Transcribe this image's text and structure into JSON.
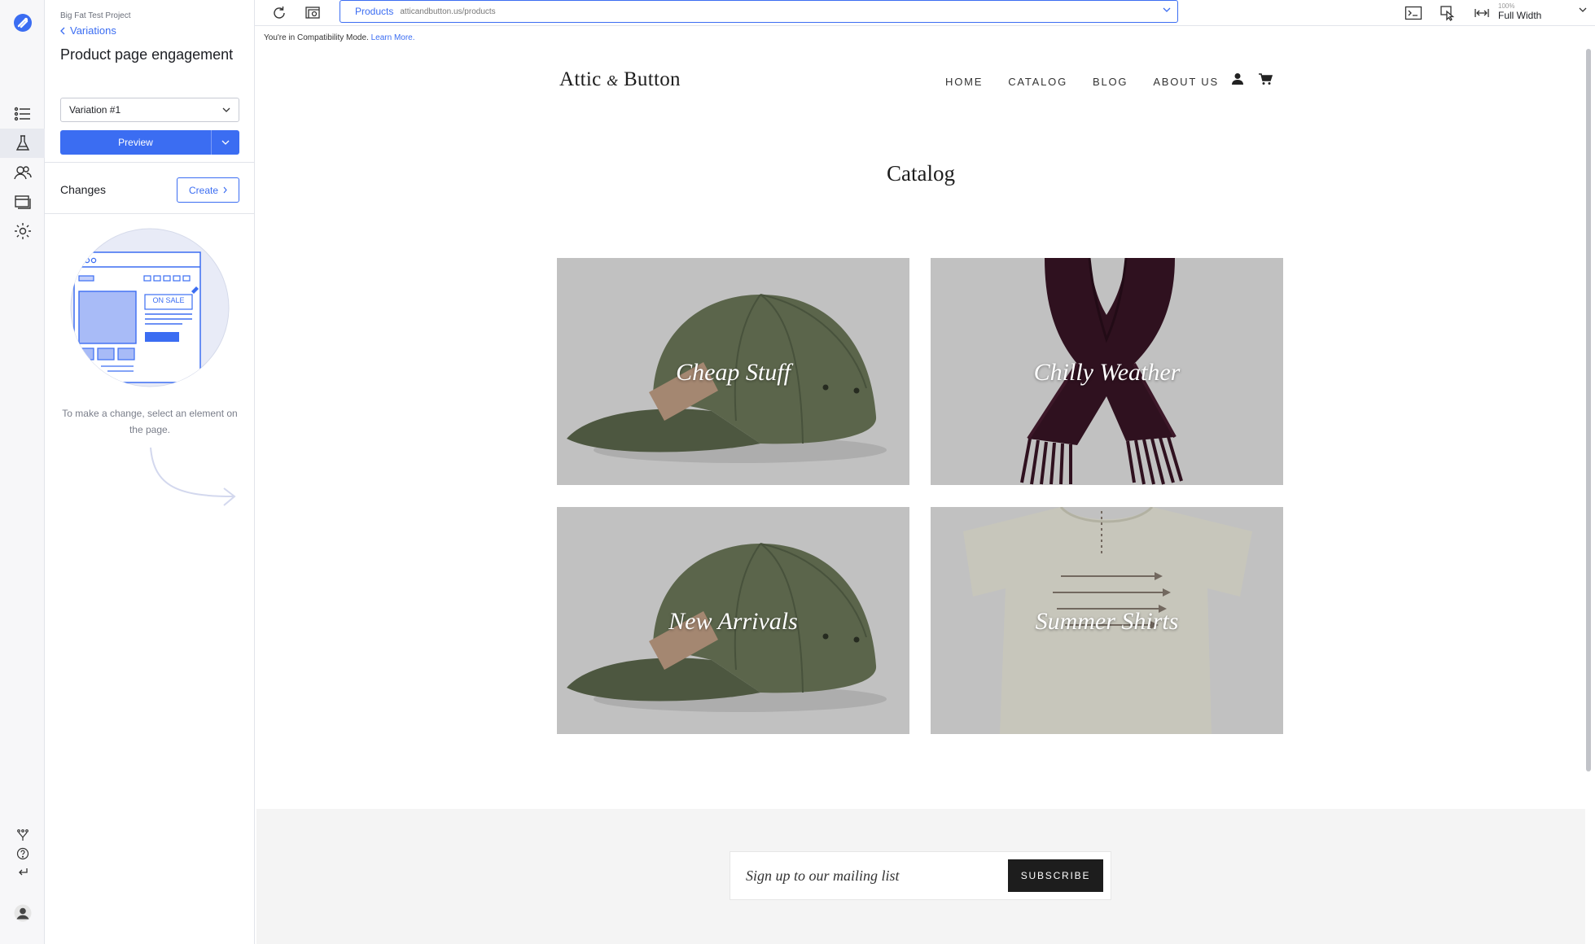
{
  "editor": {
    "project_name": "Big Fat Test Project",
    "back_label": "Variations",
    "title": "Product page engagement",
    "variation_selected": "Variation #1",
    "preview_label": "Preview",
    "changes_label": "Changes",
    "create_label": "Create",
    "hint_text": "To make a change, select an element on the page.",
    "illustration_badge": "ON SALE"
  },
  "toolbar": {
    "url_page": "Products",
    "url_address": "atticandbutton.us/products",
    "zoom_percent": "100%",
    "zoom_mode": "Full Width"
  },
  "compat": {
    "message": "You're in Compatibility Mode.",
    "link": "Learn More."
  },
  "site": {
    "logo_left": "Attic",
    "logo_amp": "&",
    "logo_right": "Button",
    "nav": [
      "HOME",
      "CATALOG",
      "BLOG",
      "ABOUT US"
    ],
    "catalog_title": "Catalog",
    "tiles": [
      {
        "label": "Cheap Stuff",
        "image": "cap"
      },
      {
        "label": "Chilly Weather",
        "image": "scarf"
      },
      {
        "label": "New Arrivals",
        "image": "cap"
      },
      {
        "label": "Summer Shirts",
        "image": "tshirt"
      }
    ],
    "signup_placeholder": "Sign up to our mailing list",
    "subscribe_label": "SUBSCRIBE"
  },
  "colors": {
    "accent": "#3b6df2",
    "dark": "#1d1d1d",
    "footer_bg": "#f4f4f4"
  }
}
